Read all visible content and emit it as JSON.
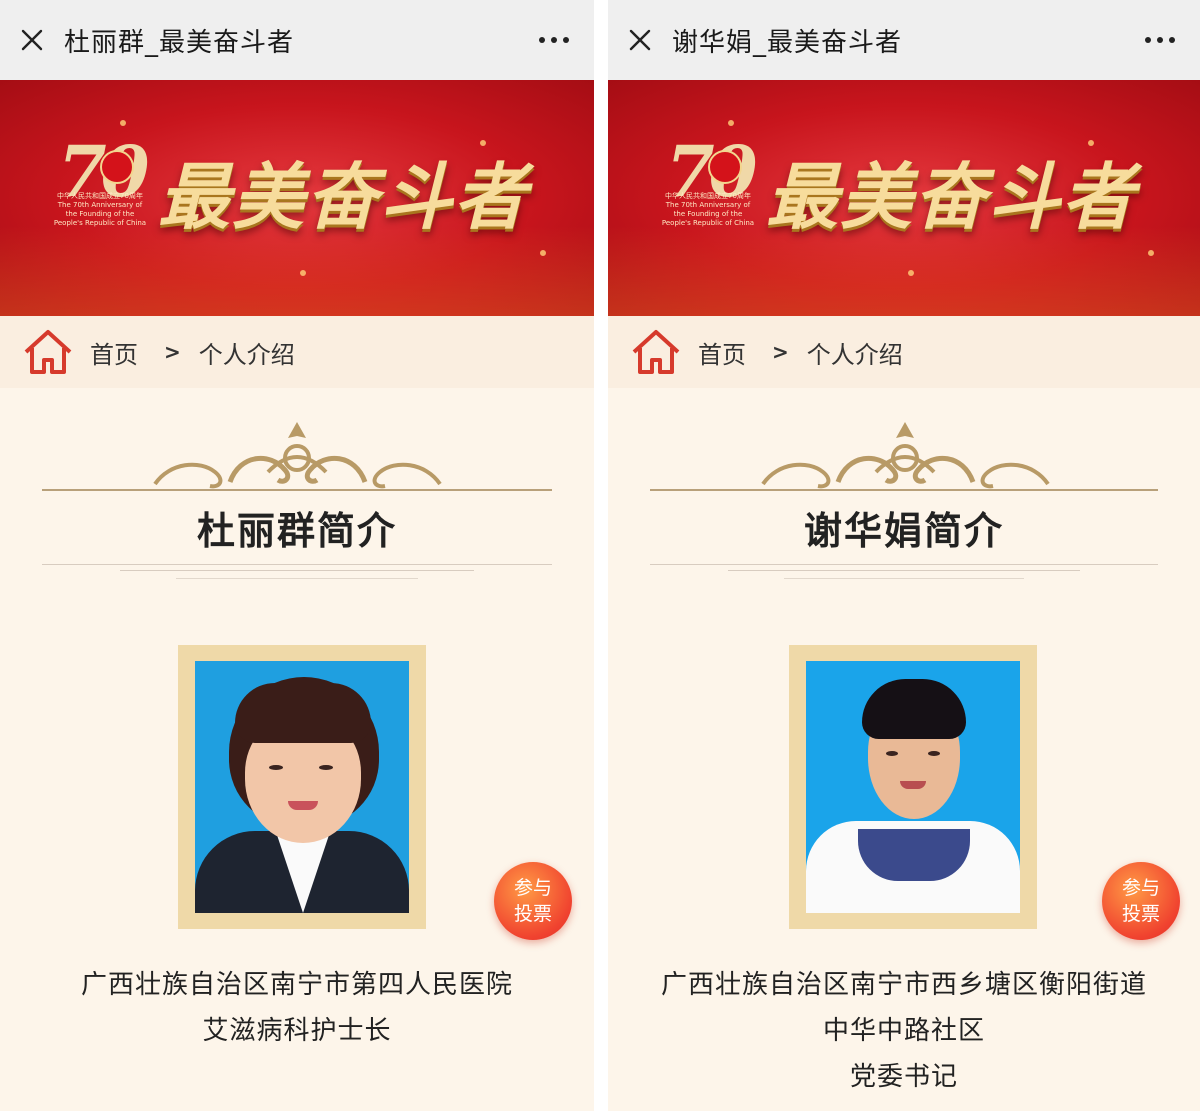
{
  "colors": {
    "banner_red": "#c8151d",
    "gold": "#f7dc9c",
    "page_background": "#fdf5ea",
    "vote_orange": "#f0422f"
  },
  "banner": {
    "title": "最美奋斗者",
    "anniversary_number": "70",
    "anniversary_caption": "中华人民共和国成立70周年 The 70th Anniversary of the Founding of the People's Republic of China"
  },
  "breadcrumb": {
    "home": "首页",
    "separator": ">",
    "current": "个人介绍"
  },
  "vote_button": {
    "line1": "参与",
    "line2": "投票"
  },
  "screens": [
    {
      "window_title": "杜丽群_最美奋斗者",
      "heading": "杜丽群简介",
      "description_lines": [
        "广西壮族自治区南宁市第四人民医院",
        "艾滋病科护士长"
      ]
    },
    {
      "window_title": "谢华娟_最美奋斗者",
      "heading": "谢华娟简介",
      "description_lines": [
        "广西壮族自治区南宁市西乡塘区衡阳街道",
        "中华中路社区",
        "党委书记"
      ]
    }
  ]
}
